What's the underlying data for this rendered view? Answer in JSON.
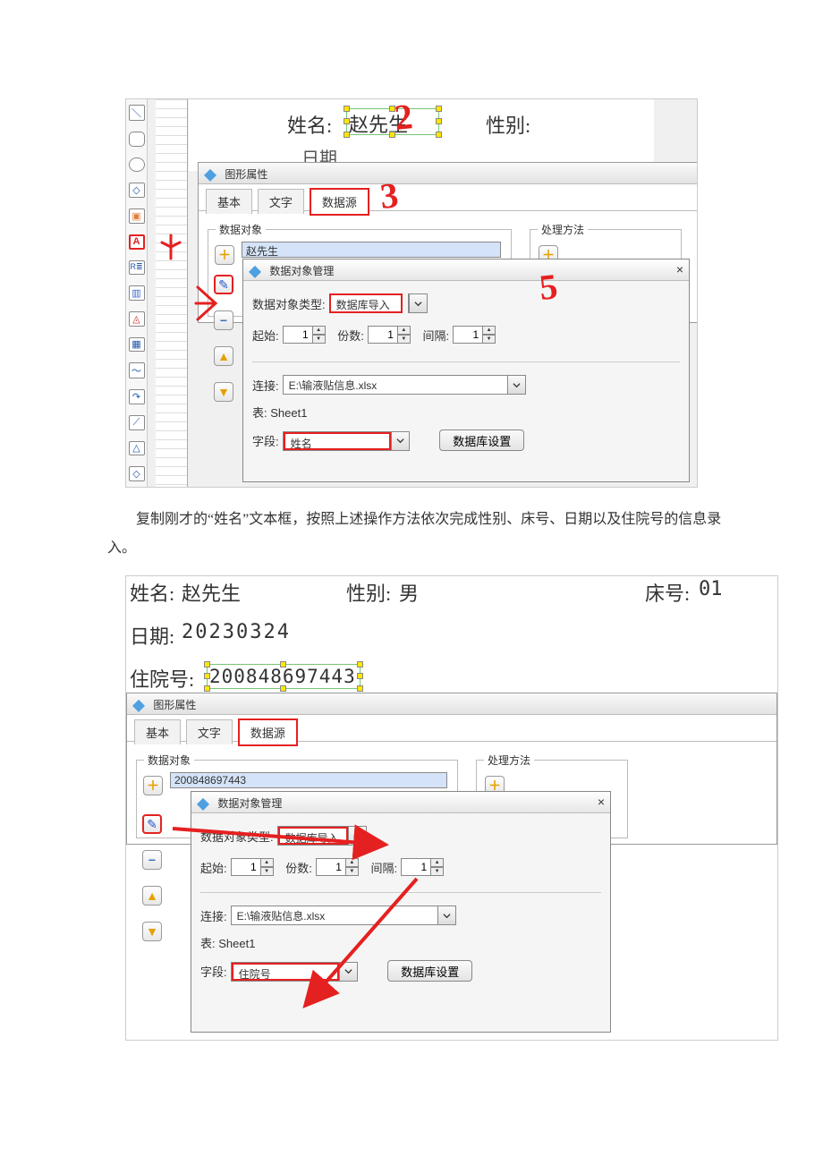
{
  "shot1": {
    "toolbar_icons": [
      "＼",
      "○",
      "○",
      "◇",
      "▣",
      "A",
      "R≣",
      "▥",
      "◬",
      "▣",
      "〜",
      "↷",
      "⟋",
      "△",
      "◇"
    ],
    "name_label": "姓名:",
    "name_value": "赵先生",
    "gender_label": "性别:",
    "date_label": "日期",
    "panel_title": "图形属性",
    "tabs": {
      "basic": "基本",
      "text": "文字",
      "data": "数据源"
    },
    "group_data_obj": "数据对象",
    "group_method": "处理方法",
    "data_item": "赵先生",
    "dom": {
      "title": "数据对象管理",
      "close": "×",
      "type_label": "数据对象类型:",
      "type_value": "数据库导入",
      "start_label": "起始:",
      "start_value": "1",
      "count_label": "份数:",
      "count_value": "1",
      "gap_label": "间隔:",
      "gap_value": "1",
      "conn_label": "连接:",
      "conn_value": "E:\\输液贴信息.xlsx",
      "sheet_label": "表: Sheet1",
      "field_label": "字段:",
      "field_value": "姓名",
      "db_btn": "数据库设置"
    },
    "ann": {
      "n2": "2",
      "n3": "3",
      "n5": "5"
    }
  },
  "body_text": "复制刚才的“姓名”文本框，按照上述操作方法依次完成性别、床号、日期以及住院号的信息录入。",
  "shot2": {
    "row1": {
      "name_label": "姓名:",
      "name_value": "赵先生",
      "gender_label": "性别:",
      "gender_value": "男",
      "bed_label": "床号:",
      "bed_value": "01"
    },
    "row2": {
      "date_label": "日期:",
      "date_value": "20230324"
    },
    "row3": {
      "hid_label": "住院号:",
      "hid_value": "200848697443"
    },
    "panel_title": "图形属性",
    "tabs": {
      "basic": "基本",
      "text": "文字",
      "data": "数据源"
    },
    "group_data_obj": "数据对象",
    "group_method": "处理方法",
    "data_item": "200848697443",
    "dom": {
      "title": "数据对象管理",
      "close": "×",
      "type_label": "数据对象类型:",
      "type_value": "数据库导入",
      "start_label": "起始:",
      "start_value": "1",
      "count_label": "份数:",
      "count_value": "1",
      "gap_label": "间隔:",
      "gap_value": "1",
      "conn_label": "连接:",
      "conn_value": "E:\\输液贴信息.xlsx",
      "sheet_label": "表: Sheet1",
      "field_label": "字段:",
      "field_value": "住院号",
      "db_btn": "数据库设置"
    }
  }
}
